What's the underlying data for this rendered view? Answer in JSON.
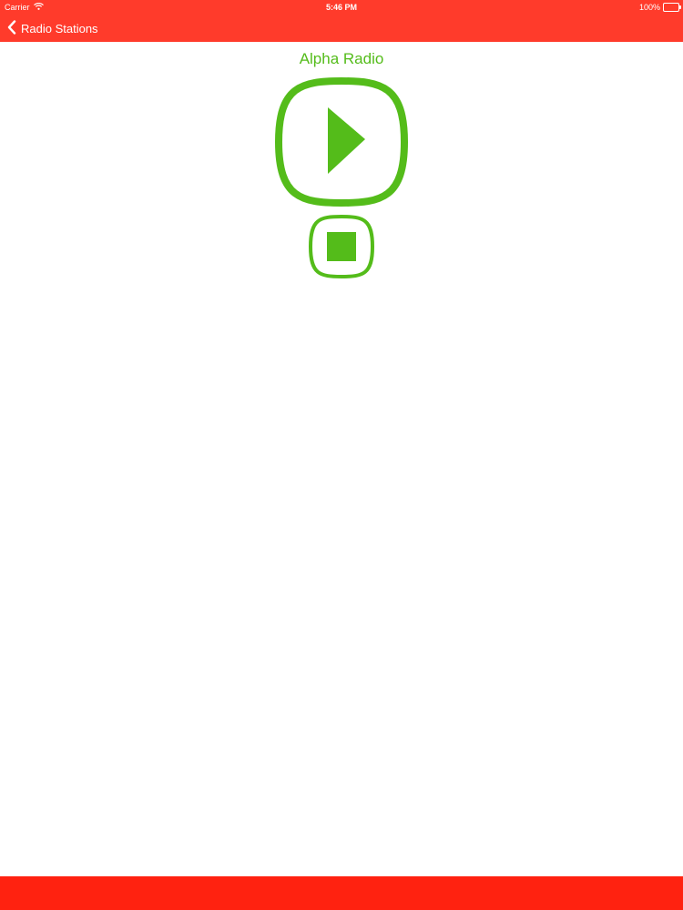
{
  "status_bar": {
    "carrier": "Carrier",
    "time": "5:46 PM",
    "battery": "100%"
  },
  "nav": {
    "back_label": "Radio Stations"
  },
  "player": {
    "station_name": "Alpha Radio",
    "play_icon": "play-icon",
    "stop_icon": "stop-icon"
  },
  "colors": {
    "accent_red": "#ff3b2b",
    "bottom_red": "#ff2210",
    "accent_green": "#54bc1a"
  }
}
